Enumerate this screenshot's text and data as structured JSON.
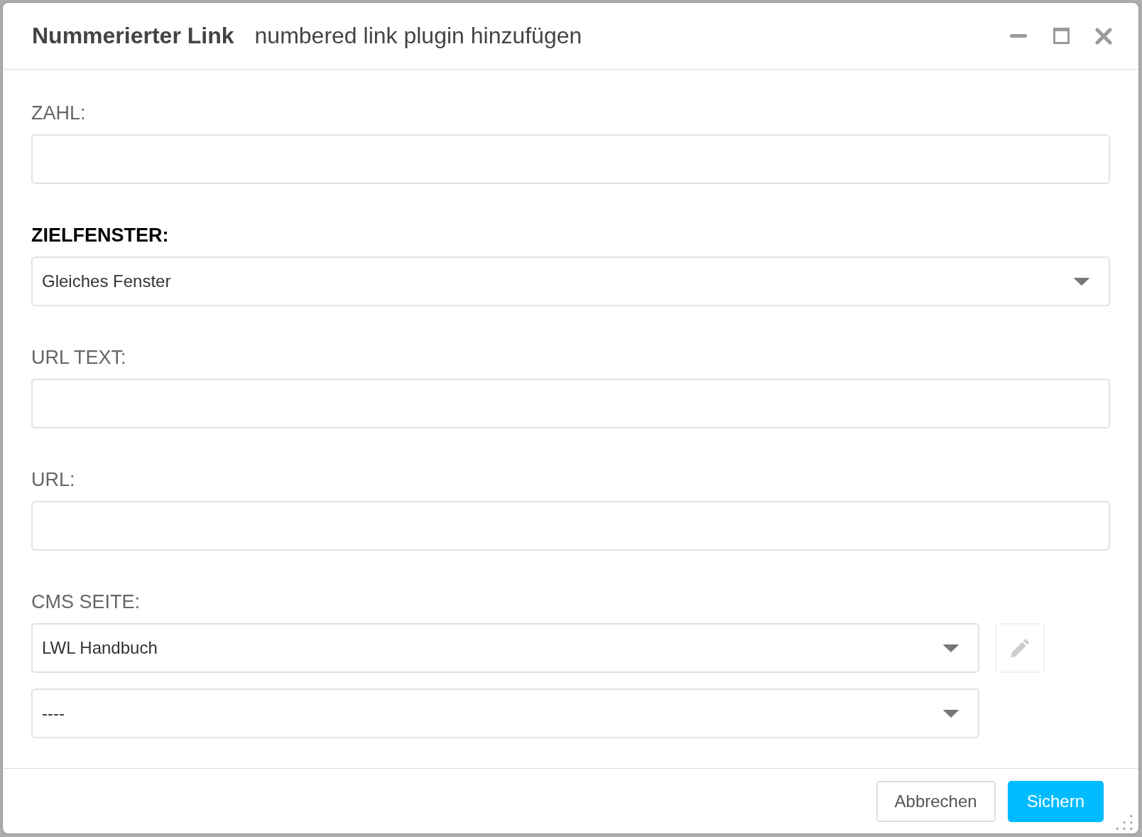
{
  "dialog": {
    "title": "Nummerierter Link",
    "subtitle": "numbered link plugin hinzufügen"
  },
  "fields": [
    {
      "label": "ZAHL:",
      "required": false,
      "kind": "input"
    },
    {
      "label": "ZIELFENSTER:",
      "required": true,
      "kind": "select",
      "value": "Gleiches Fenster"
    },
    {
      "label": "URL TEXT:",
      "required": false,
      "kind": "input"
    },
    {
      "label": "URL:",
      "required": false,
      "kind": "input"
    },
    {
      "label": "CMS SEITE:",
      "required": false,
      "kind": "page_select",
      "selects": [
        {
          "value": "LWL Handbuch",
          "edit_button": {
            "disabled": true
          }
        },
        {
          "value": "----"
        }
      ]
    }
  ],
  "buttons": [
    {
      "label": "Abbrechen",
      "kind": "cancel"
    },
    {
      "label": "Sichern",
      "kind": "save"
    }
  ]
}
